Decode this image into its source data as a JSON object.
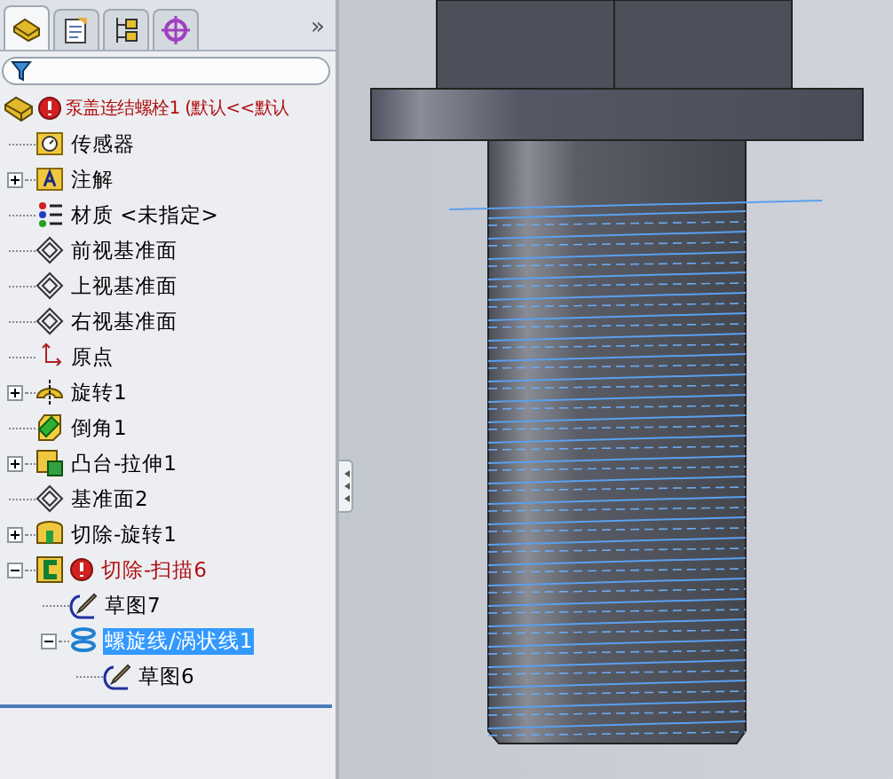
{
  "tabs": [
    {
      "kind": "feature-manager",
      "selected": true
    },
    {
      "kind": "property-manager",
      "selected": false
    },
    {
      "kind": "configuration-manager",
      "selected": false
    },
    {
      "kind": "dim-xpert",
      "selected": false
    }
  ],
  "more": "»",
  "tree": {
    "label": "泵盖连结螺栓1 (默认<<默认",
    "kind": "part",
    "error": true,
    "selected": false,
    "children": [
      {
        "label": "传感器",
        "kind": "sensor",
        "selected": false
      },
      {
        "label": "注解",
        "kind": "annotation",
        "expanded": false,
        "selected": false
      },
      {
        "label": "材质 <未指定>",
        "kind": "material",
        "selected": false
      },
      {
        "label": "前视基准面",
        "kind": "plane",
        "selected": false
      },
      {
        "label": "上视基准面",
        "kind": "plane",
        "selected": false
      },
      {
        "label": "右视基准面",
        "kind": "plane",
        "selected": false
      },
      {
        "label": "原点",
        "kind": "origin",
        "selected": false
      },
      {
        "label": "旋转1",
        "kind": "revolve",
        "expanded": false,
        "selected": false
      },
      {
        "label": "倒角1",
        "kind": "chamfer",
        "selected": false
      },
      {
        "label": "凸台-拉伸1",
        "kind": "extrude",
        "expanded": false,
        "selected": false
      },
      {
        "label": "基准面2",
        "kind": "plane",
        "selected": false
      },
      {
        "label": "切除-旋转1",
        "kind": "cut-revolve",
        "expanded": false,
        "selected": false
      },
      {
        "label": "切除-扫描6",
        "kind": "cut-sweep",
        "error": true,
        "expanded": true,
        "selected": false,
        "children": [
          {
            "label": "草图7",
            "kind": "sketch",
            "selected": false
          },
          {
            "label": "螺旋线/涡状线1",
            "kind": "helix",
            "expanded": true,
            "selected": true,
            "children": [
              {
                "label": "草图6",
                "kind": "sketch",
                "selected": false
              }
            ]
          }
        ]
      }
    ]
  }
}
